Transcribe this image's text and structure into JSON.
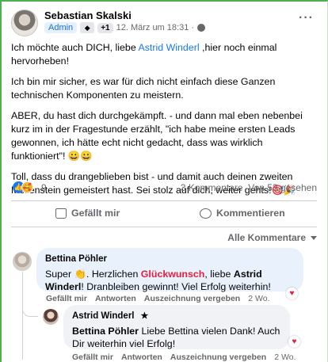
{
  "post": {
    "author": "Sebastian Skalski",
    "badge_admin": "Admin",
    "badge_plus": "+1",
    "timestamp": "12. März um 18:31 ·",
    "more": "···",
    "mention": "Astrid Winderl",
    "p1_before": "Ich möchte auch DICH, liebe ",
    "p1_after": " ,hier noch einmal hervorheben!",
    "p2": "Ich bin mir sicher, es war für dich nicht einfach diese Ganzen technischen Komponenten zu meistern.",
    "p3": "ABER, du hast dich durchgekämpft. - und dann mal eben nebenbei kurz im in der Fragestunde erzählt, \"ich habe meine ersten Leads gewonnen, ich hätte echt nicht gedacht, dass was wirklich funktioniert\"! 😀😀",
    "p4": "Toll, dass du drangeblieben bist - und damit auch deinen zweiten Meilenstein gemeistert hast. Sei stolz auf dich, weiter gehts!🎯🎉"
  },
  "reactions": {
    "count": "9",
    "comments": "3 Kommentare",
    "views": "Von 53 gesehen",
    "like_icon": "thumbs-up-icon",
    "love_icon": "care-emoji-icon"
  },
  "actions": {
    "like": "Gefällt mir",
    "comment": "Kommentieren"
  },
  "sort": {
    "label": "Alle Kommentare"
  },
  "comments": [
    {
      "name": "Bettina Pöhler",
      "text_a": "Super 👏. Herzlichen ",
      "text_red": "Glückwunsch",
      "text_b": ", liebe ",
      "text_bold": "Astrid Winderl",
      "text_c": "! Dranbleiben gewinnt! Viel Erfolg weiterhin!",
      "like": "Gefällt mir",
      "reply": "Antworten",
      "award": "Auszeichnung vergeben",
      "time": "2 Wo."
    },
    {
      "name": "Astrid Winderl",
      "star": "★",
      "text_bold": "Bettina Pöhler",
      "text": " Liebe Bettina vielen Dank! Auch Dir weiterhin viel Erfolg!",
      "like": "Gefällt mir",
      "reply": "Antworten",
      "award": "Auszeichnung vergeben",
      "time": "2 Wo."
    }
  ]
}
